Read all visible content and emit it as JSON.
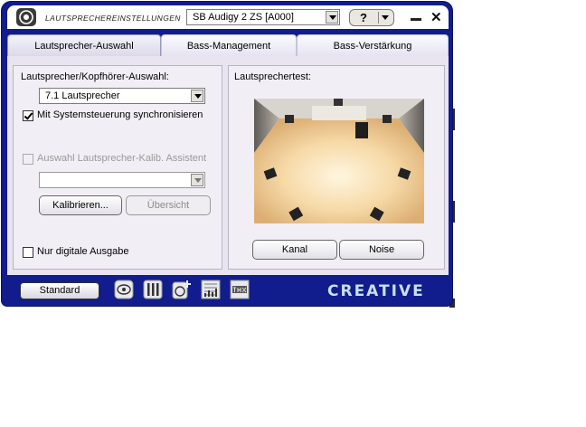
{
  "window": {
    "title": "LAUTSPRECHEREINSTELLUNGEN",
    "device_selected": "SB Audigy 2 ZS [A000]",
    "help_label": "?",
    "close_label": "✕"
  },
  "tabs": [
    {
      "label": "Lautsprecher-Auswahl",
      "active": true
    },
    {
      "label": "Bass-Management",
      "active": false
    },
    {
      "label": "Bass-Verstärkung",
      "active": false
    }
  ],
  "left_panel": {
    "speaker_select_label": "Lautsprecher/Kopfhörer-Auswahl:",
    "speaker_selected": "7.1 Lautsprecher",
    "sync_checkbox_label": "Mit Systemsteuerung synchronisieren",
    "sync_checked": true,
    "assistant_checkbox_label": "Auswahl Lautsprecher-Kalib. Assistent",
    "assistant_checked": false,
    "assistant_selected": "",
    "calibrate_button": "Kalibrieren...",
    "overview_button": "Übersicht",
    "digital_checkbox_label": "Nur digitale Ausgabe",
    "digital_checked": false
  },
  "right_panel": {
    "title": "Lautsprechertest:",
    "channel_button": "Kanal",
    "noise_button": "Noise"
  },
  "bottom_bar": {
    "standard_button": "Standard",
    "brand": "CREATIVE",
    "icons": [
      "speaker-settings-icon",
      "mixer-icon",
      "add-effect-icon",
      "equalizer-icon",
      "thx-icon"
    ]
  },
  "colors": {
    "frame": "#111d8c",
    "content_bg": "#e8e4f0",
    "brand_text": "#c8dff2"
  }
}
